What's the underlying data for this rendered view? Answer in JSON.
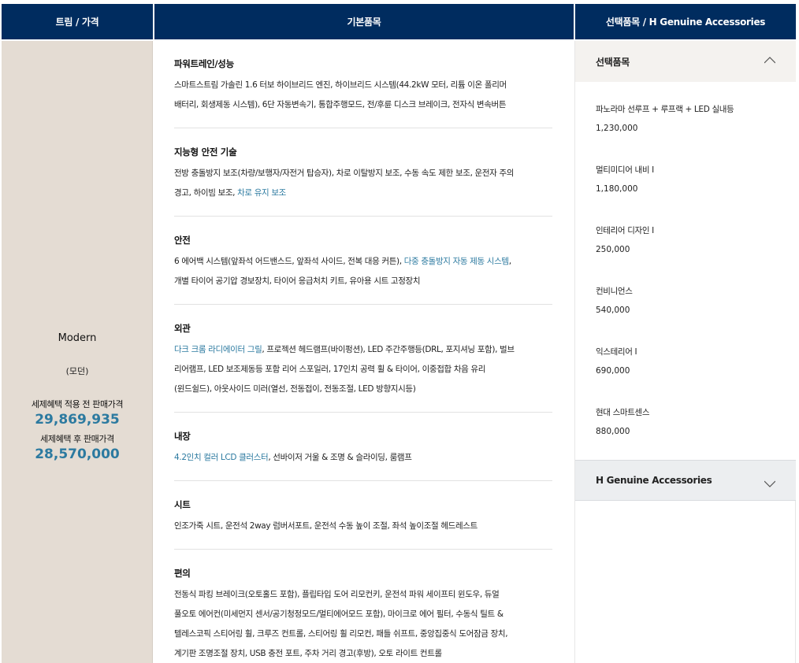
{
  "header": {
    "col_trim": "트림 / 가격",
    "col_basic": "기본품목",
    "col_options": "선택품목 / H Genuine Accessories"
  },
  "trim": {
    "name": "Modern",
    "name_ko": "(모던)",
    "price_before_label": "세제혜택 적용 전 판매가격",
    "price_before": "29,869,935",
    "price_after_label": "세제혜택 후 판매가격",
    "price_after": "28,570,000"
  },
  "basic": {
    "powertrain": {
      "title": "파워트레인/성능",
      "line1": "스마트스트림 가솔린 1.6 터보 하이브리드 엔진, 하이브리드 시스템(44.2kW 모터, 리튬 이온 폴리머",
      "line2": "배터리, 회생제동 시스템), 6단 자동변속기, 통합주행모드, 전/후륜 디스크 브레이크, 전자식 변속버튼"
    },
    "safety_tech": {
      "title": "지능형 안전 기술",
      "line1": "전방 충돌방지 보조(차량/보행자/자전거 탑승자), 차로 이탈방지 보조, 수동 속도 제한 보조, 운전자 주의",
      "line2a": "경고, 하이빔 보조, ",
      "line2_link": "차로 유지 보조"
    },
    "safety": {
      "title": "안전",
      "line1a": "6 에어백 시스템(앞좌석 어드밴스드, 앞좌석 사이드, 전복 대응 커튼), ",
      "line1_link": "다중 충돌방지 자동 제동 시스템",
      "line1b": ",",
      "line2": "개별 타이어 공기압 경보장치, 타이어 응급처치 키트, 유아용 시트 고정장치"
    },
    "exterior": {
      "title": "외관",
      "line1_link": "다크 크롬 라디에이터 그릴",
      "line1b": ", 프로젝션 헤드램프(바이펑션), LED 주간주행등(DRL, 포지셔닝 포함), 벌브",
      "line2": "리어램프, LED 보조제동등 포함 리어 스포일러, 17인치 공력 휠 & 타이어, 이중접합 차음 유리",
      "line3": "(윈드쉴드), 아웃사이드 미러(열선, 전동접이, 전동조절, LED 방향지시등)"
    },
    "interior": {
      "title": "내장",
      "line1_link": "4.2인치 컬러 LCD 클러스터",
      "line1b": ", 선바이저 거울 & 조명 & 슬라이딩, 룸램프"
    },
    "seat": {
      "title": "시트",
      "line1": "인조가죽 시트, 운전석 2way 럼버서포트, 운전석 수동 높이 조절, 좌석 높이조절 헤드레스트"
    },
    "convenience": {
      "title": "편의",
      "line1": "전동식 파킹 브레이크(오토홀드 포함), 플립타입 도어 리모컨키, 운전석 파워 세이프티 윈도우, 듀얼",
      "line2": "풀오토 에어컨(미세먼지 센서/공기청정모드/멀티에어모드 포함), 마이크로 에어 필터, 수동식 틸트 &",
      "line3": "텔레스코픽 스티어링 휠, 크루즈 컨트롤, 스티어링 휠 리모컨, 패들 쉬프트, 중앙집중식 도어잠금 장치,",
      "line4": "계기판 조명조절 장치, USB 충전 포트, 주차 거리 경고(후방), 오토 라이트 컨트롤"
    }
  },
  "options": {
    "section_title": "선택품목",
    "items": [
      {
        "name": "파노라마 선루프 + 루프랙 + LED 실내등",
        "price": "1,230,000"
      },
      {
        "name": "멀티미디어 내비 I",
        "price": "1,180,000"
      },
      {
        "name": "인테리어 디자인 I",
        "price": "250,000"
      },
      {
        "name": "컨비니언스",
        "price": "540,000"
      },
      {
        "name": "익스테리어 I",
        "price": "690,000"
      },
      {
        "name": "현대 스마트센스",
        "price": "880,000"
      }
    ],
    "accessories_title": "H Genuine Accessories"
  },
  "colors": {
    "header_bg": "#002c5f",
    "trim_bg": "#e4dcd3",
    "price_accent": "#2c7aa0",
    "link": "#2c7aa0"
  },
  "icons": {
    "options_toggle": "chevron-up-icon",
    "accessories_toggle": "chevron-down-icon"
  }
}
